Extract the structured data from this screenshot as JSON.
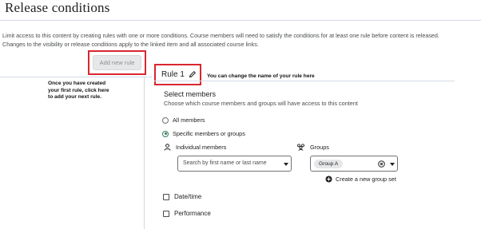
{
  "page": {
    "title": "Release conditions",
    "intro_line1": "Limit access to this content by creating rules with one or more conditions. Course members will need to satisfy the conditions for at least one rule before content is released.",
    "intro_line2": "Changes to the visibility or release conditions apply to the linked item and all associated course links."
  },
  "add_rule": {
    "label": "Add new rule"
  },
  "annotations": {
    "left_note": "Once you have created your first rule, click here to add your next rule.",
    "right_note": "You can change the name of your rule here",
    "highlight_color": "#d9262f"
  },
  "rule": {
    "name": "Rule 1",
    "edit_icon": "pencil-icon"
  },
  "members": {
    "title": "Select members",
    "subtitle": "Choose which course members and groups will have access to this content",
    "options": [
      {
        "label": "All members",
        "checked": false
      },
      {
        "label": "Specific members or groups",
        "checked": true
      }
    ],
    "accent_color": "#2e7d5b"
  },
  "individual": {
    "label": "Individual members",
    "icon": "person-icon",
    "placeholder": "Search by first name or last name"
  },
  "groups": {
    "label": "Groups",
    "icon": "group-icon",
    "selected": "Group A",
    "create_label": "Create a new group set"
  },
  "conditions": [
    {
      "label": "Date/time",
      "checked": false
    },
    {
      "label": "Performance",
      "checked": false
    }
  ]
}
